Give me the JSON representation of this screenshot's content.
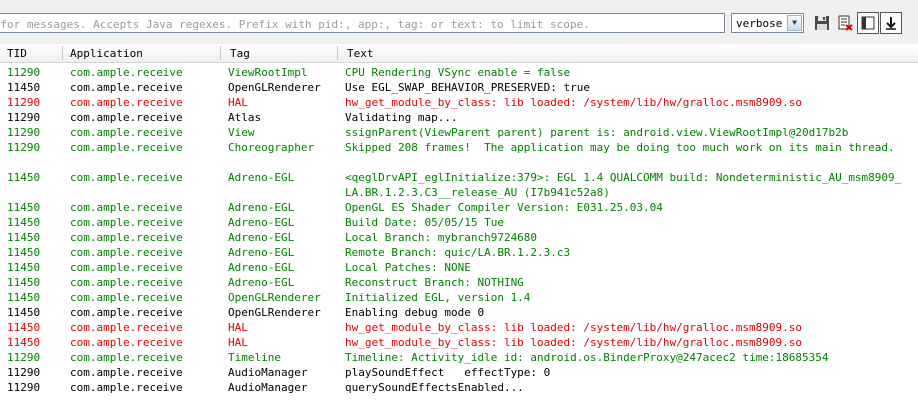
{
  "toolbar": {
    "search_placeholder": "Search for messages. Accepts Java regexes. Prefix with pid:, app:, tag: or text: to limit scope.",
    "log_level": "verbose"
  },
  "columns": {
    "tid": "TID",
    "application": "Application",
    "tag": "Tag",
    "text": "Text"
  },
  "colors": {
    "info": "#008000",
    "debug": "#000000",
    "error": "#e00000"
  },
  "rows": [
    {
      "tid": "11290",
      "app": "com.ample.receive",
      "tag": "ViewRootImpl",
      "text": "CPU Rendering VSync enable = false",
      "level": "info"
    },
    {
      "tid": "11450",
      "app": "com.ample.receive",
      "tag": "OpenGLRenderer",
      "text": "Use EGL_SWAP_BEHAVIOR_PRESERVED: true",
      "level": "debug"
    },
    {
      "tid": "11290",
      "app": "com.ample.receive",
      "tag": "HAL",
      "text": "hw_get_module_by_class: lib loaded: /system/lib/hw/gralloc.msm8909.so",
      "level": "error"
    },
    {
      "tid": "11290",
      "app": "com.ample.receive",
      "tag": "Atlas",
      "text": "Validating map...",
      "level": "debug"
    },
    {
      "tid": "11290",
      "app": "com.ample.receive",
      "tag": "View",
      "text": "ssignParent(ViewParent parent) parent is: android.view.ViewRootImpl@20d17b2b",
      "level": "info"
    },
    {
      "tid": "11290",
      "app": "com.ample.receive",
      "tag": "Choreographer",
      "text": "Skipped 208 frames!  The application may be doing too much work on its main thread.",
      "level": "info",
      "tall": true
    },
    {
      "tid": "11450",
      "app": "com.ample.receive",
      "tag": "Adreno-EGL",
      "text": "<qeglDrvAPI_eglInitialize:379>: EGL 1.4 QUALCOMM build: Nondeterministic_AU_msm8909_LA.BR.1.2.3.C3__release_AU (I7b941c52a8)",
      "level": "info",
      "tall": true
    },
    {
      "tid": "11450",
      "app": "com.ample.receive",
      "tag": "Adreno-EGL",
      "text": "OpenGL ES Shader Compiler Version: E031.25.03.04",
      "level": "info"
    },
    {
      "tid": "11450",
      "app": "com.ample.receive",
      "tag": "Adreno-EGL",
      "text": "Build Date: 05/05/15 Tue",
      "level": "info"
    },
    {
      "tid": "11450",
      "app": "com.ample.receive",
      "tag": "Adreno-EGL",
      "text": "Local Branch: mybranch9724680",
      "level": "info"
    },
    {
      "tid": "11450",
      "app": "com.ample.receive",
      "tag": "Adreno-EGL",
      "text": "Remote Branch: quic/LA.BR.1.2.3.c3",
      "level": "info"
    },
    {
      "tid": "11450",
      "app": "com.ample.receive",
      "tag": "Adreno-EGL",
      "text": "Local Patches: NONE",
      "level": "info"
    },
    {
      "tid": "11450",
      "app": "com.ample.receive",
      "tag": "Adreno-EGL",
      "text": "Reconstruct Branch: NOTHING",
      "level": "info"
    },
    {
      "tid": "11450",
      "app": "com.ample.receive",
      "tag": "OpenGLRenderer",
      "text": "Initialized EGL, version 1.4",
      "level": "info"
    },
    {
      "tid": "11450",
      "app": "com.ample.receive",
      "tag": "OpenGLRenderer",
      "text": "Enabling debug mode 0",
      "level": "debug"
    },
    {
      "tid": "11450",
      "app": "com.ample.receive",
      "tag": "HAL",
      "text": "hw_get_module_by_class: lib loaded: /system/lib/hw/gralloc.msm8909.so",
      "level": "error"
    },
    {
      "tid": "11450",
      "app": "com.ample.receive",
      "tag": "HAL",
      "text": "hw_get_module_by_class: lib loaded: /system/lib/hw/gralloc.msm8909.so",
      "level": "error"
    },
    {
      "tid": "11290",
      "app": "com.ample.receive",
      "tag": "Timeline",
      "text": "Timeline: Activity_idle id: android.os.BinderProxy@247acec2 time:18685354",
      "level": "info"
    },
    {
      "tid": "11290",
      "app": "com.ample.receive",
      "tag": "AudioManager",
      "text": "playSoundEffect   effectType: 0",
      "level": "debug"
    },
    {
      "tid": "11290",
      "app": "com.ample.receive",
      "tag": "AudioManager",
      "text": "querySoundEffectsEnabled...",
      "level": "debug"
    }
  ]
}
